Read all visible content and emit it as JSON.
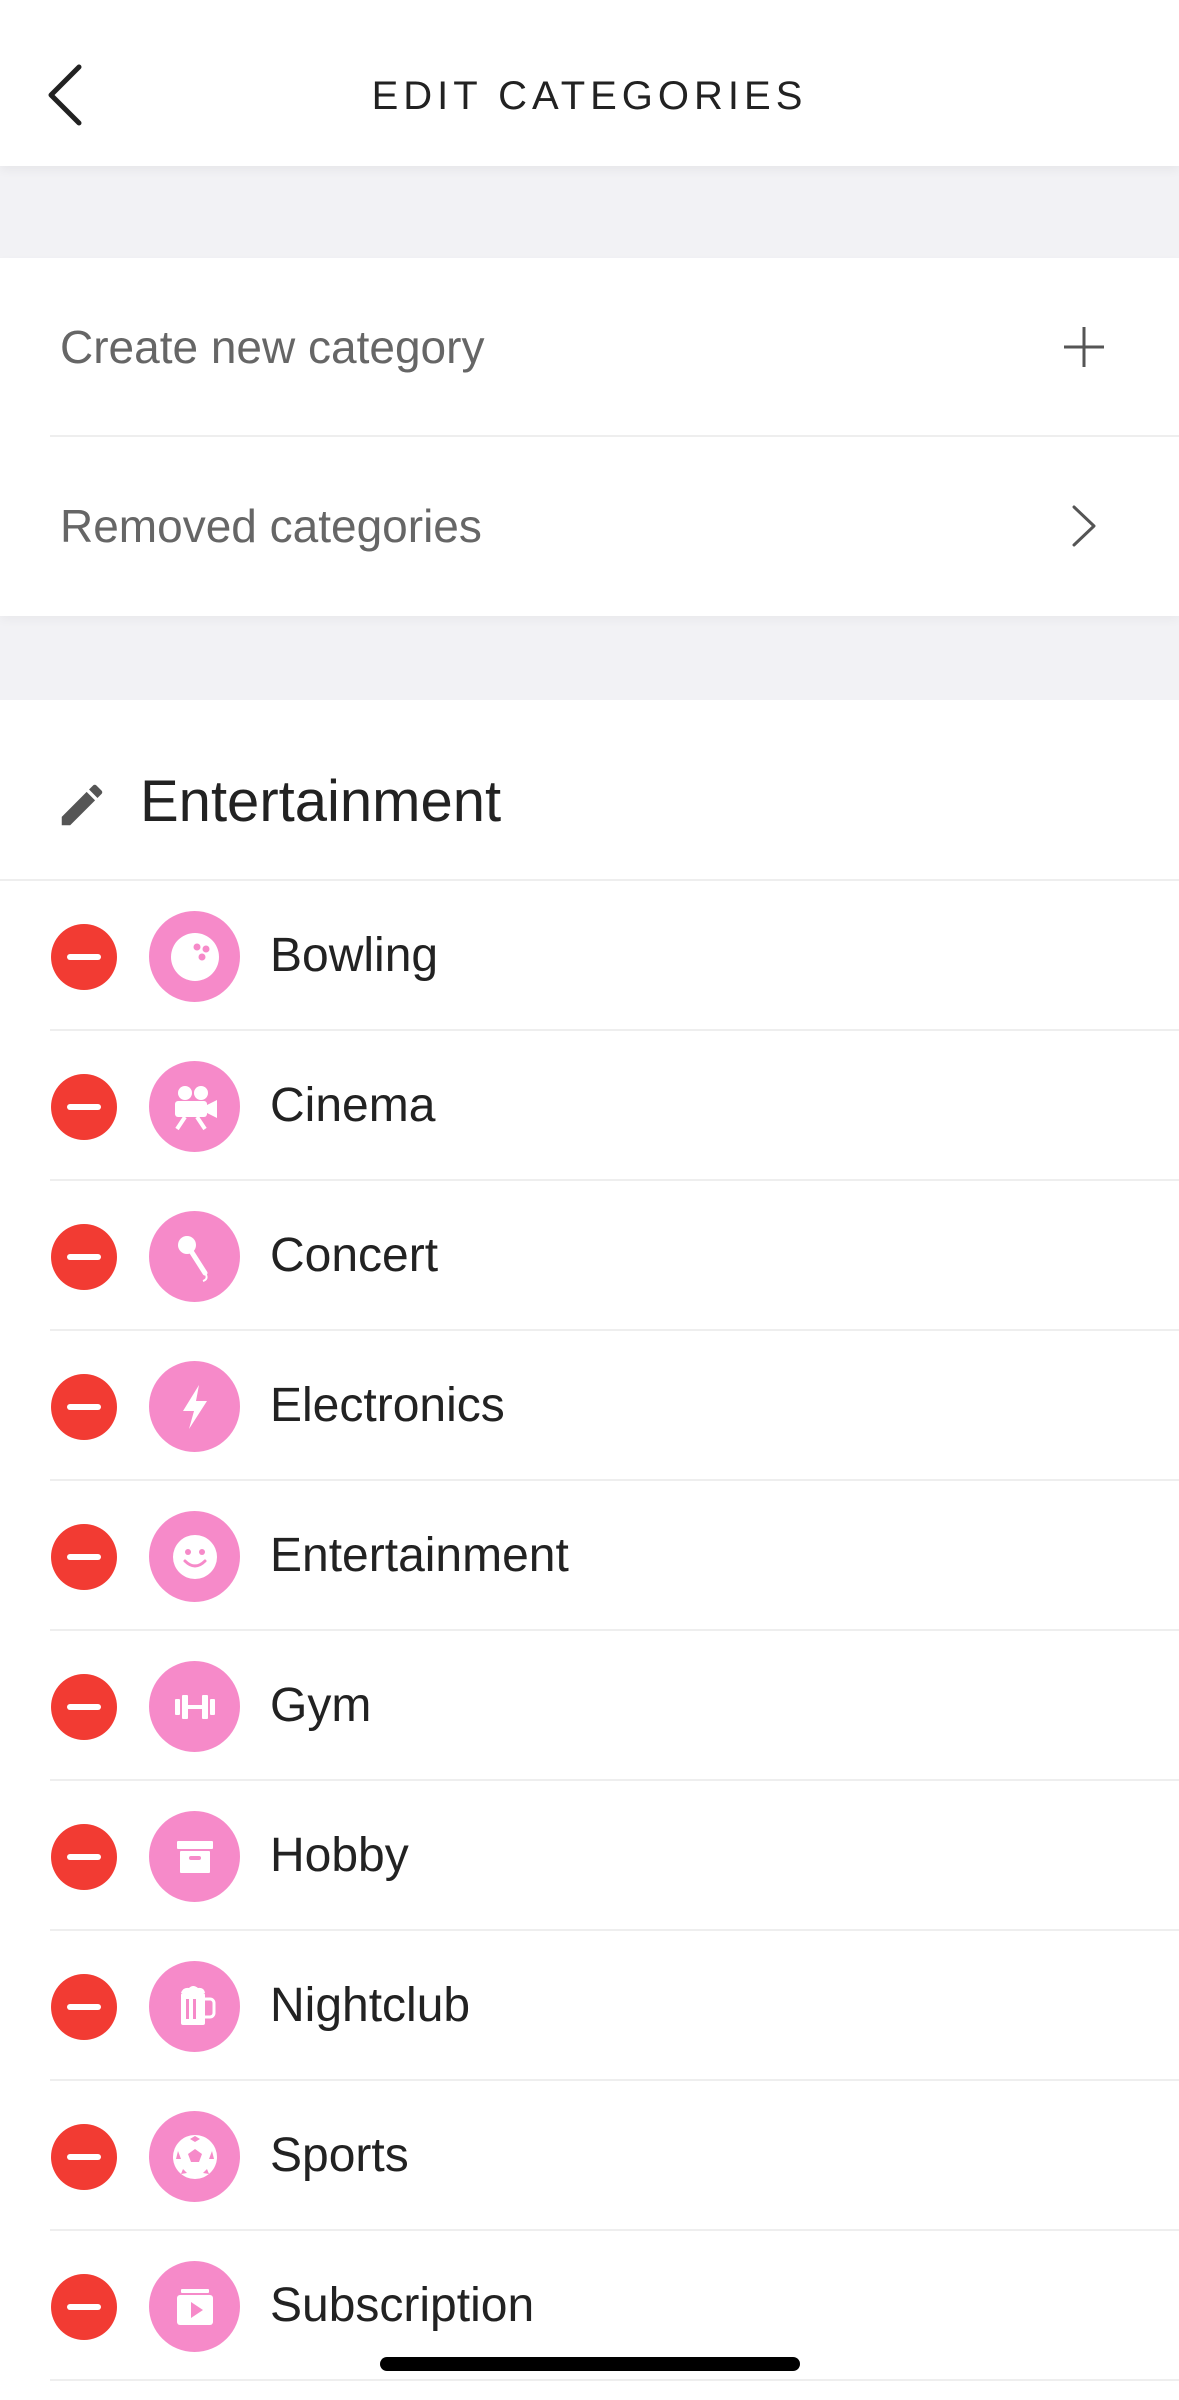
{
  "nav": {
    "title": "EDIT CATEGORIES",
    "back_icon": "chevron-left-icon"
  },
  "actions": {
    "create_label": "Create new category",
    "create_icon": "plus-icon",
    "removed_label": "Removed categories",
    "removed_icon": "chevron-right-icon"
  },
  "group": {
    "title": "Entertainment",
    "edit_icon": "pencil-icon"
  },
  "items": [
    {
      "label": "Bowling",
      "icon": "bowling-ball-icon"
    },
    {
      "label": "Cinema",
      "icon": "movie-camera-icon"
    },
    {
      "label": "Concert",
      "icon": "microphone-icon"
    },
    {
      "label": "Electronics",
      "icon": "lightning-bolt-icon"
    },
    {
      "label": "Entertainment",
      "icon": "smiley-icon"
    },
    {
      "label": "Gym",
      "icon": "dumbbell-icon"
    },
    {
      "label": "Hobby",
      "icon": "archive-box-icon"
    },
    {
      "label": "Nightclub",
      "icon": "beer-mug-icon"
    },
    {
      "label": "Sports",
      "icon": "soccer-ball-icon"
    },
    {
      "label": "Subscription",
      "icon": "play-box-icon"
    }
  ],
  "colors": {
    "remove": "#f23b33",
    "category_icon_bg": "#f68ac9",
    "background": "#f2f2f5"
  }
}
